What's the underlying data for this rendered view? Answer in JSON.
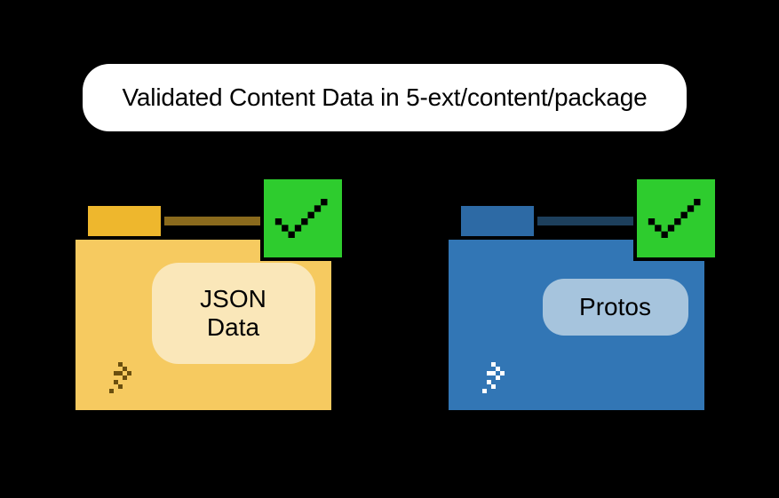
{
  "header": {
    "title": "Validated Content Data in 5-ext/content/package"
  },
  "folders": [
    {
      "id": "json-data",
      "label": "JSON\nData",
      "color": "yellow",
      "checkmark": true
    },
    {
      "id": "protos",
      "label": "Protos",
      "color": "blue",
      "checkmark": true
    }
  ],
  "colors": {
    "background": "#000000",
    "checkmark_bg": "#2ecc2e",
    "folder_yellow_body": "#f6ca60",
    "folder_yellow_tab": "#eeb72d",
    "folder_blue_body": "#3276b5",
    "folder_blue_tab": "#2d6aa5",
    "pill_bg": "#ffffff"
  }
}
